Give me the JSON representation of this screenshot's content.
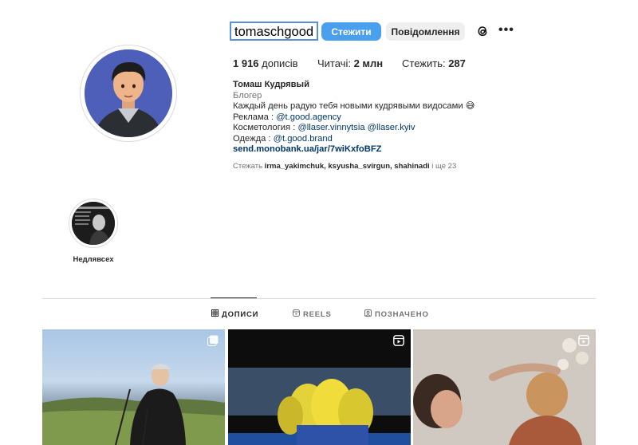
{
  "profile": {
    "username": "tomaschgood",
    "follow_label": "Стежити",
    "message_label": "Повідомлення",
    "more_label": "•••"
  },
  "stats": {
    "posts_count": "1 916",
    "posts_label": "дописів",
    "followers_label": "Читачі:",
    "followers_count": "2 млн",
    "following_label": "Стежить:",
    "following_count": "287"
  },
  "bio": {
    "name": "Томаш Кудрявый",
    "category": "Блогер",
    "line1": "Каждый день радую тебя новыми кудрявыми видосами 😅",
    "ads_label": "Реклама : ",
    "ads_link": "@t.good.agency",
    "cosmetics_label": "Косметология : ",
    "cosmetics_link1": "@llaser.vinnytsia",
    "cosmetics_link2": "@llaser.kyiv",
    "clothes_label": "Одежда : ",
    "clothes_link": "@t.good.brand",
    "website": "send.monobank.ua/jar/7wiKxfoBFZ"
  },
  "followed_by": {
    "prefix": "Стежать",
    "names": "irma_yakimchuk, ksyusha_svirgun, shahinadi",
    "suffix": "і ще 23"
  },
  "highlights": [
    {
      "label": "Недлявсех"
    }
  ],
  "tabs": [
    {
      "label": "ДОПИСИ",
      "icon": "grid-icon",
      "active": true
    },
    {
      "label": "REELS",
      "icon": "reels-icon",
      "active": false
    },
    {
      "label": "ПОЗНАЧЕНО",
      "icon": "tagged-icon",
      "active": false
    }
  ],
  "posts": [
    {
      "type": "carousel",
      "badge": "carousel-icon"
    },
    {
      "type": "reel",
      "badge": "reels-icon"
    },
    {
      "type": "reel",
      "badge": "reels-icon"
    }
  ],
  "colors": {
    "follow_button": "#4a9fef",
    "link": "#00376b",
    "muted": "#737373"
  }
}
